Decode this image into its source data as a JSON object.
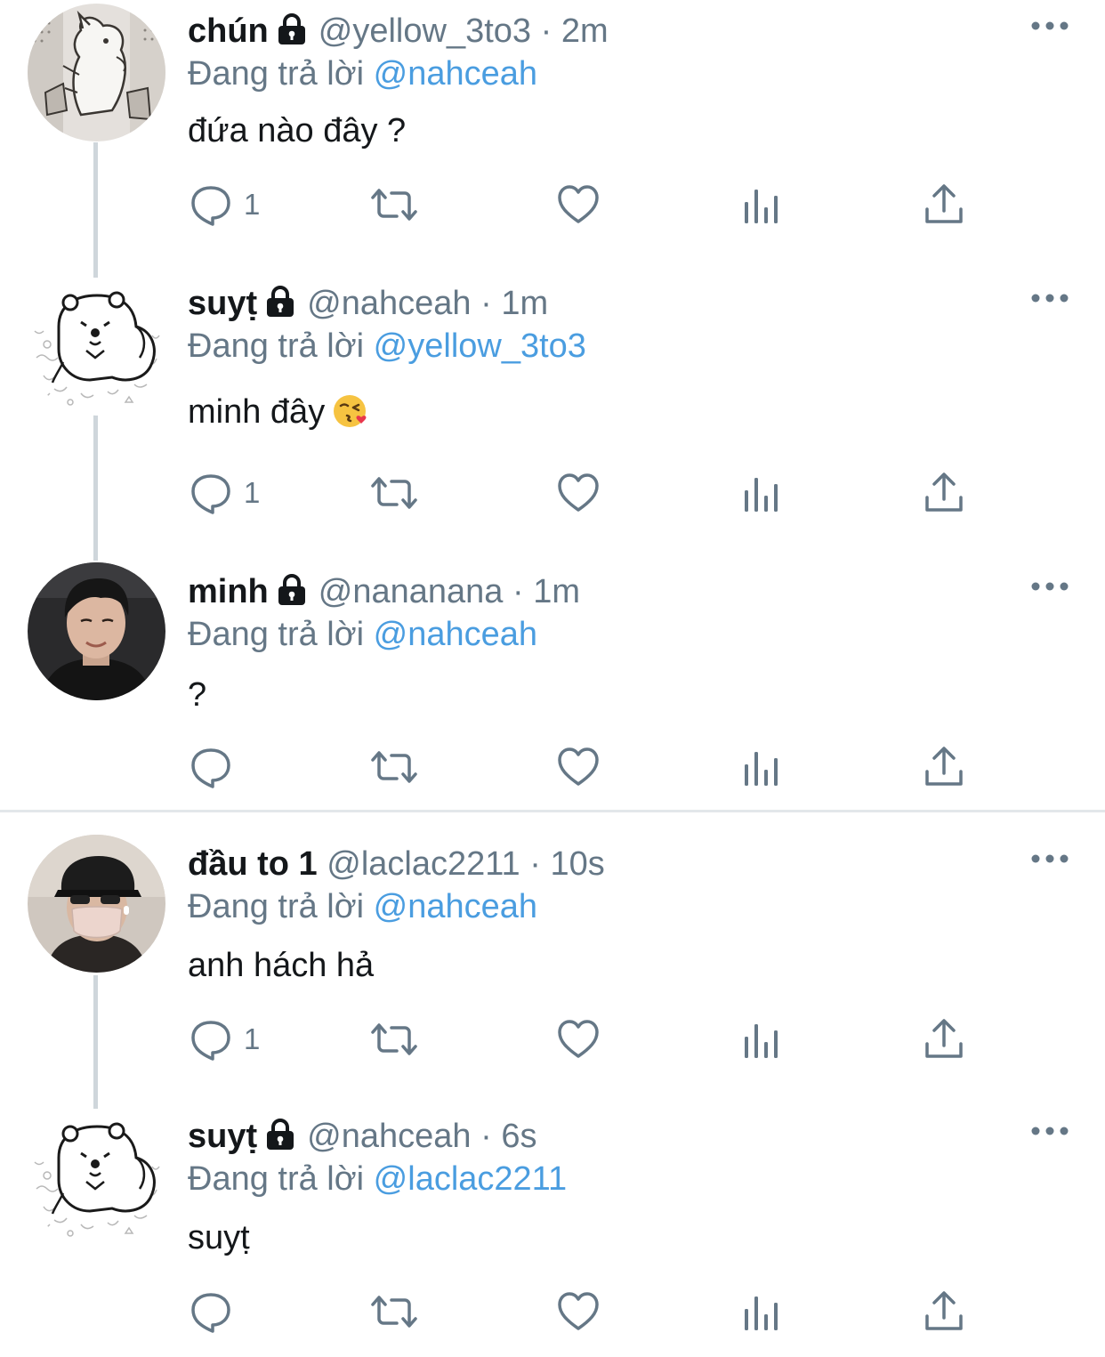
{
  "replying_prefix": "Đang trả lời",
  "colors": {
    "primary_text": "#14171a",
    "secondary_text": "#657786",
    "mention": "#4a9de0",
    "thread_line": "#cfd6db",
    "divider": "#e3e7ea"
  },
  "tweets": [
    {
      "name": "chún",
      "handle": "@yellow_3to3",
      "time": "2m",
      "reply_to": "@nahceah",
      "text": "đứa nào đây ?",
      "reply_count": "1",
      "avatar": "moomin-comic-avatar"
    },
    {
      "name": "suyt",
      "name_display": "suyṭ",
      "handle": "@nahceah",
      "time": "1m",
      "reply_to": "@yellow_3to3",
      "text": "minh đây",
      "emoji": "kissing-face-emoji",
      "reply_count": "1",
      "avatar": "bear-doodle-avatar"
    },
    {
      "name": "minh",
      "handle": "@nananana",
      "time": "1m",
      "reply_to": "@nahceah",
      "text": "?",
      "reply_count": "",
      "avatar": "person-photo-avatar"
    },
    {
      "name": "đầu to 1",
      "handle": "@laclac2211",
      "time": "10s",
      "reply_to": "@nahceah",
      "text": "anh hách hả",
      "reply_count": "1",
      "avatar": "cap-mask-photo-avatar"
    },
    {
      "name": "suyṭ",
      "handle": "@nahceah",
      "time": "6s",
      "reply_to": "@laclac2211",
      "text": "suyṭ",
      "reply_count": "",
      "avatar": "bear-doodle-avatar"
    }
  ]
}
